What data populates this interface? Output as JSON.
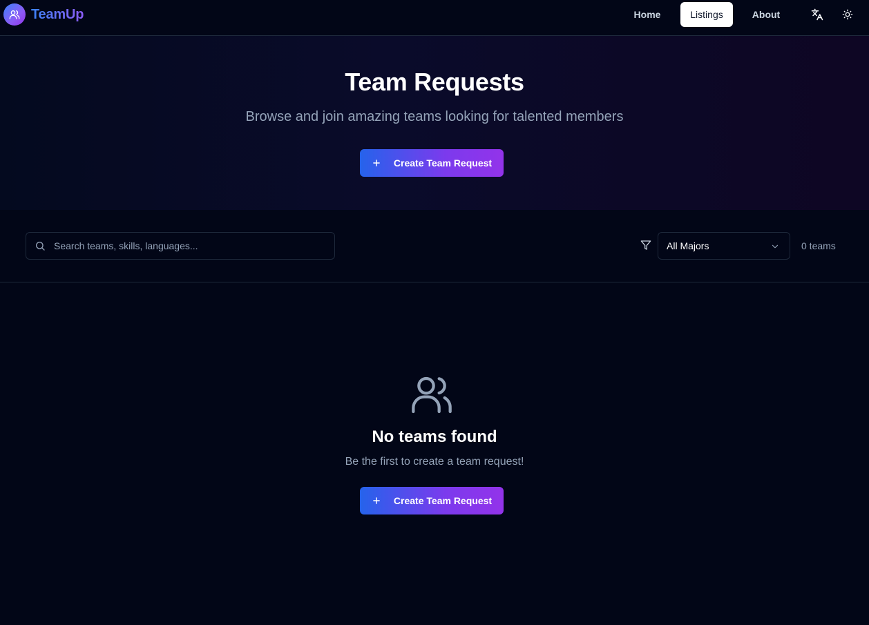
{
  "brand": {
    "name": "TeamUp",
    "logo_icon": "users-icon"
  },
  "nav": {
    "items": [
      {
        "label": "Home",
        "active": false
      },
      {
        "label": "Listings",
        "active": true
      },
      {
        "label": "About",
        "active": false
      }
    ],
    "language_icon": "translate-icon",
    "theme_icon": "sun-icon"
  },
  "hero": {
    "title": "Team Requests",
    "subtitle": "Browse and join amazing teams looking for talented members",
    "cta_label": "Create Team Request"
  },
  "filters": {
    "search_placeholder": "Search teams, skills, languages...",
    "search_value": "",
    "major_selected": "All Majors",
    "count_text": "0 teams"
  },
  "empty_state": {
    "icon": "users-icon",
    "title": "No teams found",
    "subtitle": "Be the first to create a team request!",
    "cta_label": "Create Team Request"
  },
  "colors": {
    "background": "#020617",
    "accent_start": "#2563eb",
    "accent_end": "#9333ea",
    "muted_text": "#94a3b8",
    "border": "#1e293b"
  }
}
